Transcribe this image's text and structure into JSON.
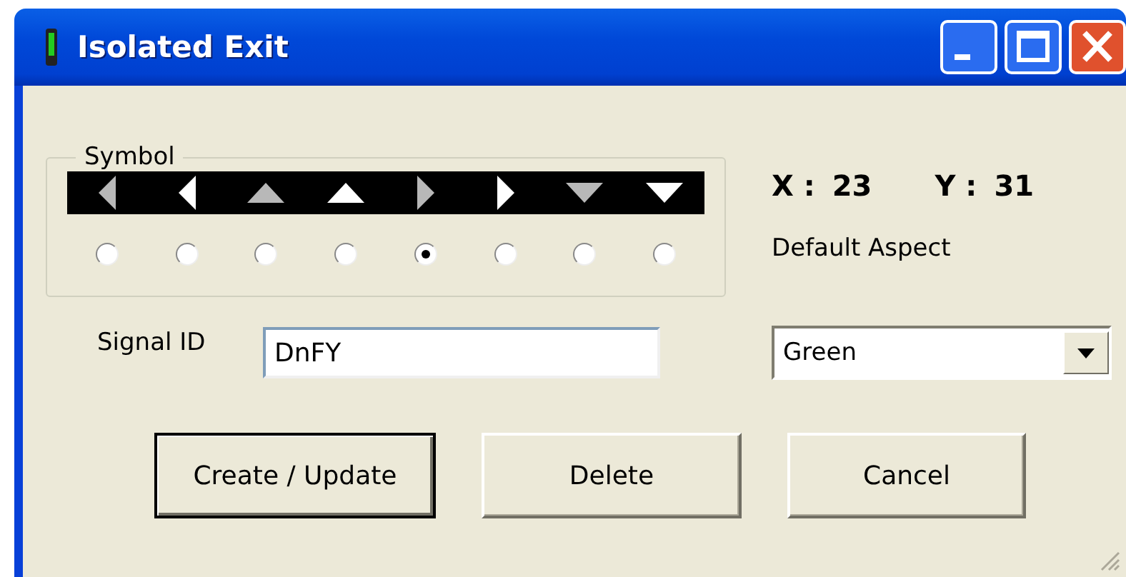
{
  "window": {
    "title": "Isolated Exit"
  },
  "symbol_group": {
    "legend": "Symbol",
    "symbols": [
      {
        "kind": "left",
        "dim": true,
        "selected": false
      },
      {
        "kind": "left",
        "dim": false,
        "selected": false
      },
      {
        "kind": "up",
        "dim": true,
        "selected": false
      },
      {
        "kind": "up",
        "dim": false,
        "selected": false
      },
      {
        "kind": "right",
        "dim": true,
        "selected": true
      },
      {
        "kind": "right",
        "dim": false,
        "selected": false
      },
      {
        "kind": "down",
        "dim": true,
        "selected": false
      },
      {
        "kind": "down",
        "dim": false,
        "selected": false
      }
    ]
  },
  "coordinates": {
    "x_label": "X :",
    "x_value": "23",
    "y_label": "Y :",
    "y_value": "31"
  },
  "default_aspect": {
    "label": "Default Aspect",
    "value": "Green"
  },
  "signal_id": {
    "label": "Signal ID",
    "value": "DnFY"
  },
  "buttons": [
    {
      "label": "Create / Update",
      "default": true
    },
    {
      "label": "Delete",
      "default": false
    },
    {
      "label": "Cancel",
      "default": false
    }
  ]
}
